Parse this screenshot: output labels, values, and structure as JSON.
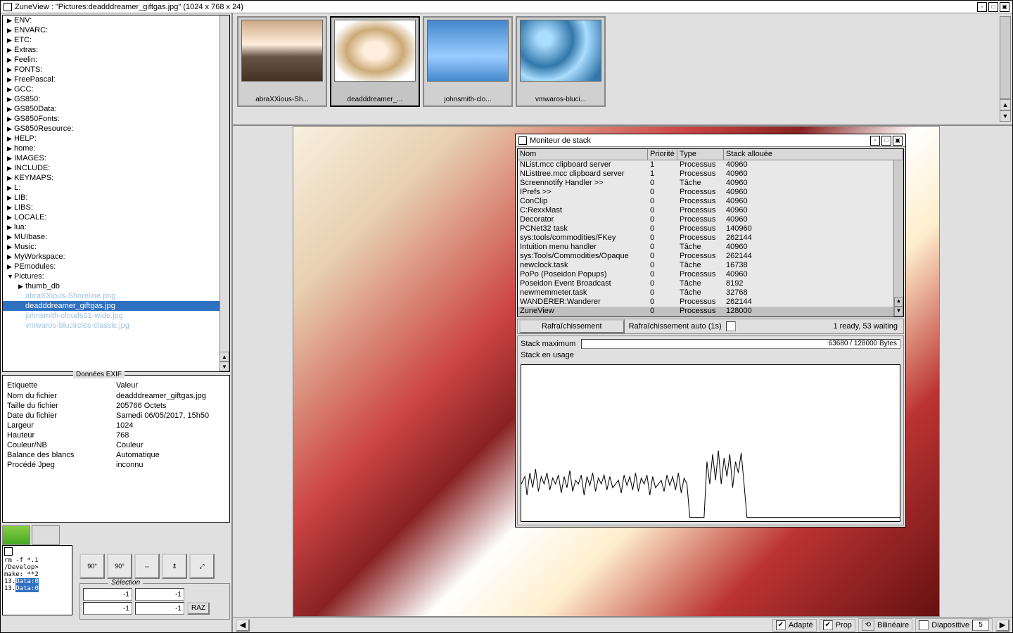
{
  "main": {
    "title": "ZuneView : \"Pictures:deadddreamer_giftgas.jpg\" (1024 x 768 x 24)"
  },
  "tree": {
    "items": [
      {
        "label": "ENV:",
        "depth": 0,
        "arrow": "▶"
      },
      {
        "label": "ENVARC:",
        "depth": 0,
        "arrow": "▶"
      },
      {
        "label": "ETC:",
        "depth": 0,
        "arrow": "▶"
      },
      {
        "label": "Extras:",
        "depth": 0,
        "arrow": "▶"
      },
      {
        "label": "Feelin:",
        "depth": 0,
        "arrow": "▶"
      },
      {
        "label": "FONTS:",
        "depth": 0,
        "arrow": "▶"
      },
      {
        "label": "FreePascal:",
        "depth": 0,
        "arrow": "▶"
      },
      {
        "label": "GCC:",
        "depth": 0,
        "arrow": "▶"
      },
      {
        "label": "GS850:",
        "depth": 0,
        "arrow": "▶"
      },
      {
        "label": "GS850Data:",
        "depth": 0,
        "arrow": "▶"
      },
      {
        "label": "GS850Fonts:",
        "depth": 0,
        "arrow": "▶"
      },
      {
        "label": "GS850Resource:",
        "depth": 0,
        "arrow": "▶"
      },
      {
        "label": "HELP:",
        "depth": 0,
        "arrow": "▶"
      },
      {
        "label": "home:",
        "depth": 0,
        "arrow": "▶"
      },
      {
        "label": "IMAGES:",
        "depth": 0,
        "arrow": "▶"
      },
      {
        "label": "INCLUDE:",
        "depth": 0,
        "arrow": "▶"
      },
      {
        "label": "KEYMAPS:",
        "depth": 0,
        "arrow": "▶"
      },
      {
        "label": "L:",
        "depth": 0,
        "arrow": "▶"
      },
      {
        "label": "LIB:",
        "depth": 0,
        "arrow": "▶"
      },
      {
        "label": "LIBS:",
        "depth": 0,
        "arrow": "▶"
      },
      {
        "label": "LOCALE:",
        "depth": 0,
        "arrow": "▶"
      },
      {
        "label": "lua:",
        "depth": 0,
        "arrow": "▶"
      },
      {
        "label": "MUIbase:",
        "depth": 0,
        "arrow": "▶"
      },
      {
        "label": "Music:",
        "depth": 0,
        "arrow": "▶"
      },
      {
        "label": "MyWorkspace:",
        "depth": 0,
        "arrow": "▶"
      },
      {
        "label": "PEmodules:",
        "depth": 0,
        "arrow": "▶"
      },
      {
        "label": "Pictures:",
        "depth": 0,
        "arrow": "▼"
      },
      {
        "label": "thumb_db",
        "depth": 1,
        "arrow": "▶"
      },
      {
        "label": "abraXXious-Shoreline.png",
        "depth": 1,
        "arrow": "",
        "faded": true
      },
      {
        "label": "deadddreamer_giftgas.jpg",
        "depth": 1,
        "arrow": "",
        "selected": true
      },
      {
        "label": "johnsmith-clouds01-wide.jpg",
        "depth": 1,
        "arrow": "",
        "faded": true
      },
      {
        "label": "vmwaros-blucircles-classic.jpg",
        "depth": 1,
        "arrow": "",
        "faded": true
      }
    ]
  },
  "exif": {
    "title": "Données EXIF",
    "headers": {
      "label": "Etiquette",
      "value": "Valeur"
    },
    "rows": [
      {
        "label": "Nom du fichier",
        "value": "deadddreamer_giftgas.jpg"
      },
      {
        "label": "Taille du fichier",
        "value": "205766 Octets"
      },
      {
        "label": "Date du fichier",
        "value": "Samedi 06/05/2017, 15h50"
      },
      {
        "label": "Largeur",
        "value": "1024"
      },
      {
        "label": "Hauteur",
        "value": "768"
      },
      {
        "label": "Couleur/NB",
        "value": "Couleur"
      },
      {
        "label": "Balance des blancs",
        "value": "Automatique"
      },
      {
        "label": "Procédé Jpeg",
        "value": "inconnu"
      }
    ]
  },
  "terminal": {
    "lines": [
      "rm -f *.i",
      "/Develop>",
      "make: **2",
      "13.Data:0",
      "13.Data:0"
    ]
  },
  "tools": {
    "rotate_left": "90°",
    "rotate_right": "90°"
  },
  "selection": {
    "title": "Sélection",
    "x1": "-1",
    "y1": "-1",
    "x2": "-1",
    "y2": "-1",
    "raz": "RAZ"
  },
  "thumbs": [
    {
      "label": "abraXXious-Sh...",
      "cls": "thumb-sunset"
    },
    {
      "label": "deadddreamer_...",
      "cls": "thumb-dreamer",
      "selected": true
    },
    {
      "label": "johnsmith-clo...",
      "cls": "thumb-clouds"
    },
    {
      "label": "vmwaros-bluci...",
      "cls": "thumb-circles"
    }
  ],
  "bottom": {
    "adapte": "Adapté",
    "prop": "Prop",
    "bilineaire": "Bilinéaire",
    "diapositive": "Diapositive",
    "diap_num": "5"
  },
  "stack": {
    "title": "Moniteur de stack",
    "headers": {
      "nom": "Nom",
      "prio": "Priorité",
      "type": "Type",
      "stack": "Stack allouée"
    },
    "rows": [
      {
        "nom": "NList.mcc clipboard server",
        "prio": "1",
        "type": "Processus",
        "stack": "40960"
      },
      {
        "nom": "NListtree.mcc clipboard server",
        "prio": "1",
        "type": "Processus",
        "stack": "40960"
      },
      {
        "nom": "Screennotify Handler >>",
        "prio": "0",
        "type": "Tâche",
        "stack": "40960"
      },
      {
        "nom": "IPrefs >>",
        "prio": "0",
        "type": "Processus",
        "stack": "40960"
      },
      {
        "nom": "ConClip",
        "prio": "0",
        "type": "Processus",
        "stack": "40960"
      },
      {
        "nom": "C:RexxMast",
        "prio": "0",
        "type": "Processus",
        "stack": "40960"
      },
      {
        "nom": "Decorator",
        "prio": "0",
        "type": "Processus",
        "stack": "40960"
      },
      {
        "nom": "PCNet32 task",
        "prio": "0",
        "type": "Processus",
        "stack": "140960"
      },
      {
        "nom": "sys:tools/commodities/FKey",
        "prio": "0",
        "type": "Processus",
        "stack": "262144"
      },
      {
        "nom": "Intuition menu handler",
        "prio": "0",
        "type": "Tâche",
        "stack": "40960"
      },
      {
        "nom": "sys:Tools/Commodities/Opaque",
        "prio": "0",
        "type": "Processus",
        "stack": "262144"
      },
      {
        "nom": "newclock.task",
        "prio": "0",
        "type": "Tâche",
        "stack": "16738"
      },
      {
        "nom": "PoPo (Poseidon Popups)",
        "prio": "0",
        "type": "Processus",
        "stack": "40960"
      },
      {
        "nom": "Poseidon Event Broadcast",
        "prio": "0",
        "type": "Tâche",
        "stack": "8192"
      },
      {
        "nom": "newmemmeter.task",
        "prio": "0",
        "type": "Tâche",
        "stack": "32768"
      },
      {
        "nom": "WANDERER:Wanderer",
        "prio": "0",
        "type": "Processus",
        "stack": "262144"
      },
      {
        "nom": "ZuneView",
        "prio": "0",
        "type": "Processus",
        "stack": "128000",
        "sel": true
      }
    ],
    "refresh_btn": "Rafraîchissement",
    "auto_label": "Rafraîchissement auto (1s)",
    "status": "1 ready, 53 waiting",
    "max_label": "Stack maximum",
    "max_value": "63680 / 128000 Bytes",
    "usage_label": "Stack en usage"
  }
}
